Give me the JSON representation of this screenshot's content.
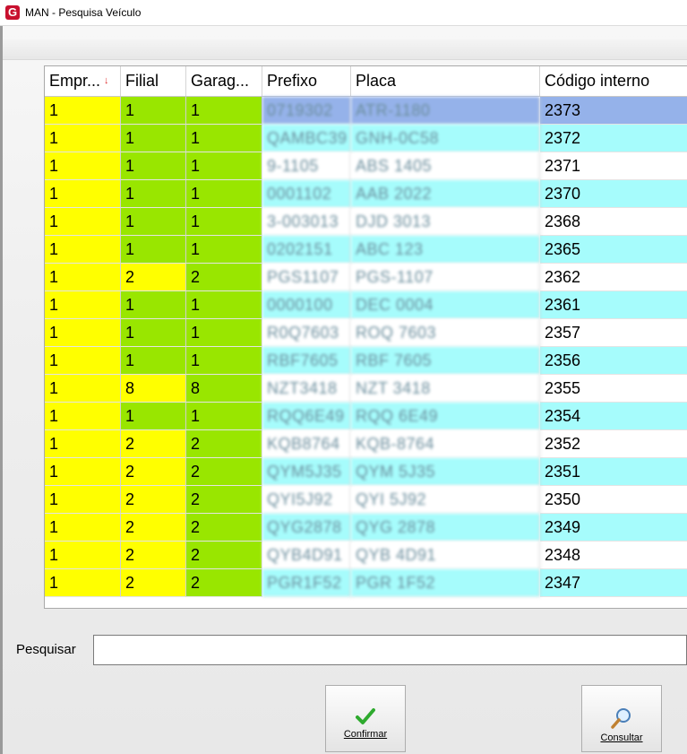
{
  "window": {
    "title": "MAN - Pesquisa Veículo"
  },
  "grid": {
    "columns": [
      "Empr...",
      "Filial",
      "Garag...",
      "Prefixo",
      "Placa",
      "Código interno"
    ],
    "rows": [
      {
        "empresa": "1",
        "filial": "1",
        "garagem": "1",
        "prefixo": "0719302",
        "placa": "ATR-1180",
        "codigo": "2373"
      },
      {
        "empresa": "1",
        "filial": "1",
        "garagem": "1",
        "prefixo": "QAMBC39",
        "placa": "GNH-0C58",
        "codigo": "2372"
      },
      {
        "empresa": "1",
        "filial": "1",
        "garagem": "1",
        "prefixo": "9-1105",
        "placa": "ABS 1405",
        "codigo": "2371"
      },
      {
        "empresa": "1",
        "filial": "1",
        "garagem": "1",
        "prefixo": "0001102",
        "placa": "AAB 2022",
        "codigo": "2370"
      },
      {
        "empresa": "1",
        "filial": "1",
        "garagem": "1",
        "prefixo": "3-003013",
        "placa": "DJD 3013",
        "codigo": "2368"
      },
      {
        "empresa": "1",
        "filial": "1",
        "garagem": "1",
        "prefixo": "0202151",
        "placa": "ABC 123",
        "codigo": "2365"
      },
      {
        "empresa": "1",
        "filial": "2",
        "garagem": "2",
        "prefixo": "PGS1107",
        "placa": "PGS-1107",
        "codigo": "2362"
      },
      {
        "empresa": "1",
        "filial": "1",
        "garagem": "1",
        "prefixo": "0000100",
        "placa": "DEC 0004",
        "codigo": "2361"
      },
      {
        "empresa": "1",
        "filial": "1",
        "garagem": "1",
        "prefixo": "R0Q7603",
        "placa": "ROQ 7603",
        "codigo": "2357"
      },
      {
        "empresa": "1",
        "filial": "1",
        "garagem": "1",
        "prefixo": "RBF7605",
        "placa": "RBF 7605",
        "codigo": "2356"
      },
      {
        "empresa": "1",
        "filial": "8",
        "garagem": "8",
        "prefixo": "NZT3418",
        "placa": "NZT 3418",
        "codigo": "2355"
      },
      {
        "empresa": "1",
        "filial": "1",
        "garagem": "1",
        "prefixo": "RQQ6E49",
        "placa": "RQQ 6E49",
        "codigo": "2354"
      },
      {
        "empresa": "1",
        "filial": "2",
        "garagem": "2",
        "prefixo": "KQB8764",
        "placa": "KQB-8764",
        "codigo": "2352"
      },
      {
        "empresa": "1",
        "filial": "2",
        "garagem": "2",
        "prefixo": "QYM5J35",
        "placa": "QYM 5J35",
        "codigo": "2351"
      },
      {
        "empresa": "1",
        "filial": "2",
        "garagem": "2",
        "prefixo": "QYI5J92",
        "placa": "QYI 5J92",
        "codigo": "2350"
      },
      {
        "empresa": "1",
        "filial": "2",
        "garagem": "2",
        "prefixo": "QYG2878",
        "placa": "QYG 2878",
        "codigo": "2349"
      },
      {
        "empresa": "1",
        "filial": "2",
        "garagem": "2",
        "prefixo": "QYB4D91",
        "placa": "QYB 4D91",
        "codigo": "2348"
      },
      {
        "empresa": "1",
        "filial": "2",
        "garagem": "2",
        "prefixo": "PGR1F52",
        "placa": "PGR 1F52",
        "codigo": "2347"
      }
    ],
    "colors": {
      "yellow": "#ffff00",
      "green": "#99e600",
      "cyan": "#a6fcfc",
      "selected": "#95b2ea"
    }
  },
  "search": {
    "label": "Pesquisar",
    "value": ""
  },
  "buttons": {
    "confirm": "Confirmar",
    "consult": "Consultar"
  }
}
